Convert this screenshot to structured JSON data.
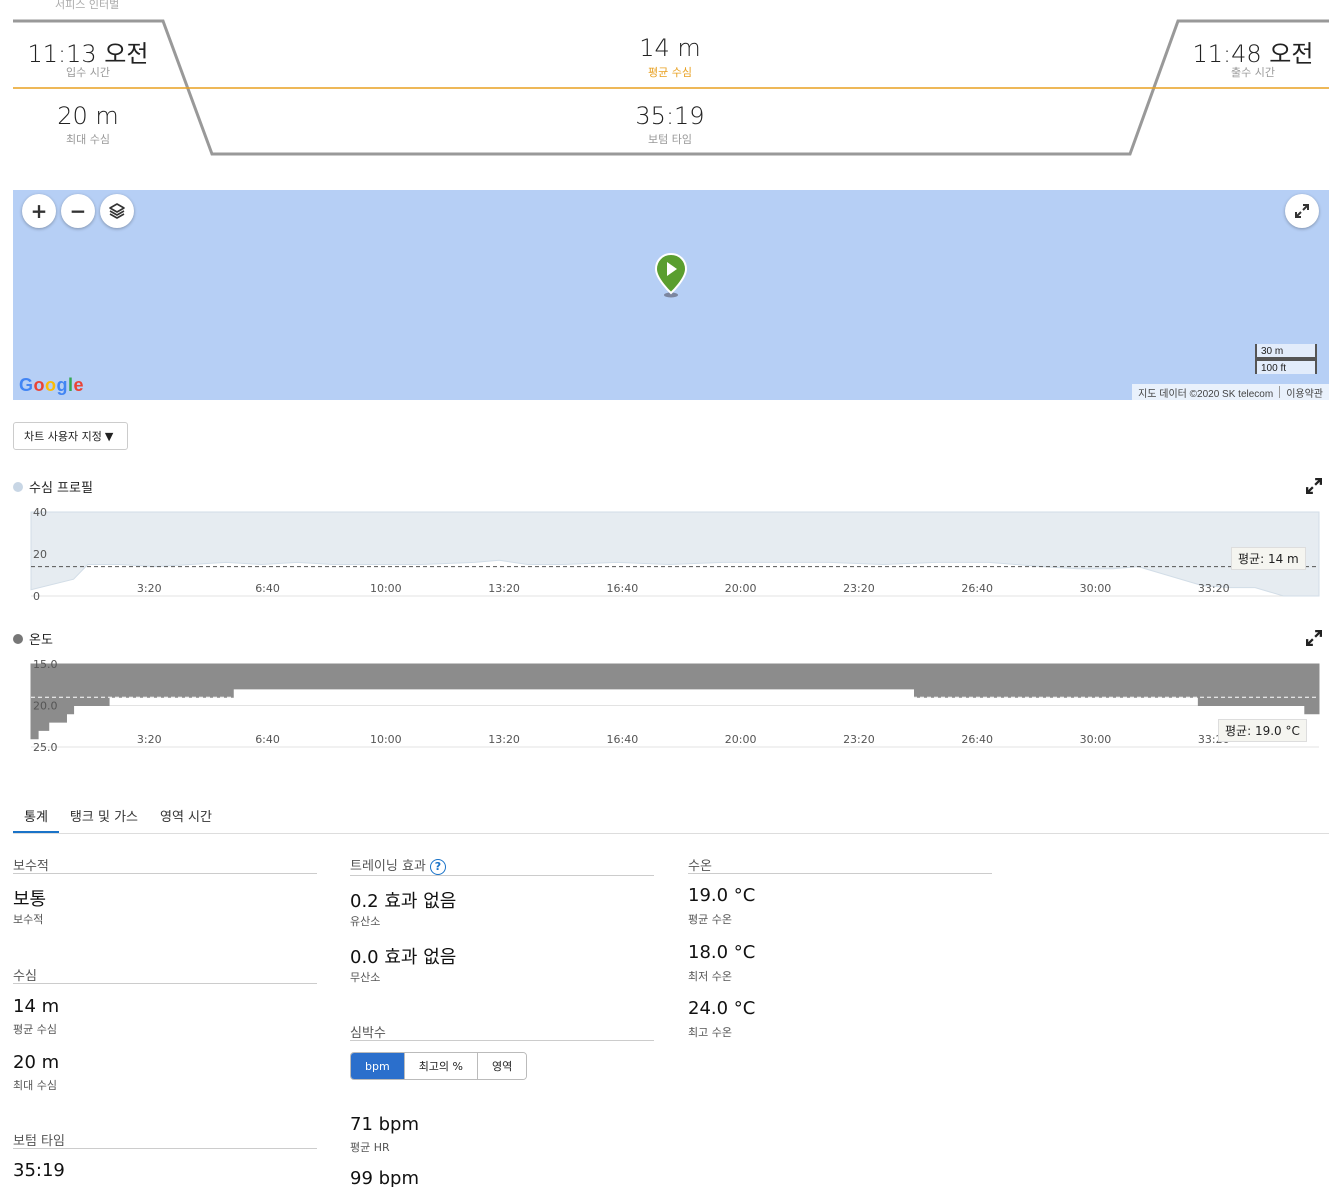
{
  "dive_summary": {
    "top_faint_label": "서피스 인터벌",
    "entry_time": {
      "value": "11:13 오전",
      "label": "입수 시간"
    },
    "avg_depth": {
      "value": "14 m",
      "label": "평균 수심"
    },
    "exit_time": {
      "value": "11:48 오전",
      "label": "출수 시간"
    },
    "max_depth": {
      "value": "20 m",
      "label": "최대 수심"
    },
    "bottom_time": {
      "value": "35:19",
      "label": "보텀 타임"
    }
  },
  "map": {
    "zoom_in": "+",
    "zoom_out": "−",
    "logo": [
      "G",
      "o",
      "o",
      "g",
      "l",
      "e"
    ],
    "scale_metric": "30 m",
    "scale_imperial": "100 ft",
    "attribution": "지도 데이터 ©2020 SK telecom",
    "terms": "이용약관",
    "colors": {
      "water": "#b6cff5",
      "marker": "#5a9e2f"
    }
  },
  "customize_button": "차트 사용자 지정",
  "depth_chart": {
    "title": "수심 프로필",
    "avg_label": "평균: 14 m"
  },
  "temp_chart": {
    "title": "온도",
    "avg_label": "평균: 19.0 °C"
  },
  "chart_data": [
    {
      "type": "area",
      "title": "수심 프로필",
      "x_ticks": [
        "3:20",
        "6:40",
        "10:00",
        "13:20",
        "16:40",
        "20:00",
        "23:20",
        "26:40",
        "30:00",
        "33:20"
      ],
      "y_ticks": [
        "0",
        "20",
        "40"
      ],
      "ylim": [
        40,
        0
      ],
      "xlim": [
        0,
        36.3
      ],
      "x_minutes": [
        0,
        1.2,
        1.6,
        2.5,
        3.5,
        4.5,
        5.5,
        6.5,
        7.5,
        8.5,
        10,
        11,
        12.5,
        13.2,
        14,
        15,
        16.5,
        18,
        19.5,
        21,
        22.5,
        24,
        25.5,
        27,
        28.5,
        29.5,
        30.5,
        31.2,
        32,
        33,
        33.8,
        34.5,
        35.3,
        36.3
      ],
      "depth_m": [
        3,
        8,
        15,
        15,
        14,
        15,
        16,
        15,
        16,
        15,
        15,
        15,
        16,
        17,
        15,
        15,
        16,
        15,
        16,
        16,
        16,
        15,
        16,
        16,
        14,
        13,
        13,
        14,
        10,
        5,
        4,
        4,
        0,
        0
      ],
      "average": 14,
      "grid": true
    },
    {
      "type": "area",
      "title": "온도",
      "x_ticks": [
        "3:20",
        "6:40",
        "10:00",
        "13:20",
        "16:40",
        "20:00",
        "23:20",
        "26:40",
        "30:00",
        "33:20"
      ],
      "y_ticks": [
        "25.0",
        "20.0",
        "15.0"
      ],
      "ylim": [
        15,
        25
      ],
      "xlim": [
        0,
        36.3
      ],
      "x_minutes": [
        0,
        0.2,
        0.5,
        0.9,
        1.0,
        1.2,
        2.2,
        5.7,
        24.9,
        32.9,
        35.9,
        36.3
      ],
      "temp_c": [
        24,
        23,
        22,
        22,
        21,
        20,
        19,
        18,
        19,
        20,
        21,
        21
      ],
      "average": 19.0,
      "grid": true
    }
  ],
  "tabs": [
    "통계",
    "탱크 및 가스",
    "영역 시간"
  ],
  "stats": {
    "conservatism": {
      "title": "보수적",
      "value": "보통",
      "label": "보수적"
    },
    "depth": {
      "title": "수심",
      "avg_value": "14 m",
      "avg_label": "평균 수심",
      "max_value": "20 m",
      "max_label": "최대 수심"
    },
    "bottom_time": {
      "title": "보텀 타임",
      "value": "35:19"
    },
    "training": {
      "title": "트레이닝 효과",
      "help": "?",
      "aerobic_value": "0.2 효과 없음",
      "aerobic_label": "유산소",
      "anaerobic_value": "0.0 효과 없음",
      "anaerobic_label": "무산소"
    },
    "heart_rate": {
      "title": "심박수",
      "segments": [
        "bpm",
        "최고의 %",
        "영역"
      ],
      "avg_value": "71 bpm",
      "avg_label": "평균 HR",
      "max_value": "99 bpm"
    },
    "water_temp": {
      "title": "수온",
      "avg_value": "19.0 °C",
      "avg_label": "평균 수온",
      "min_value": "18.0 °C",
      "min_label": "최저 수온",
      "max_value": "24.0 °C",
      "max_label": "최고 수온"
    }
  }
}
